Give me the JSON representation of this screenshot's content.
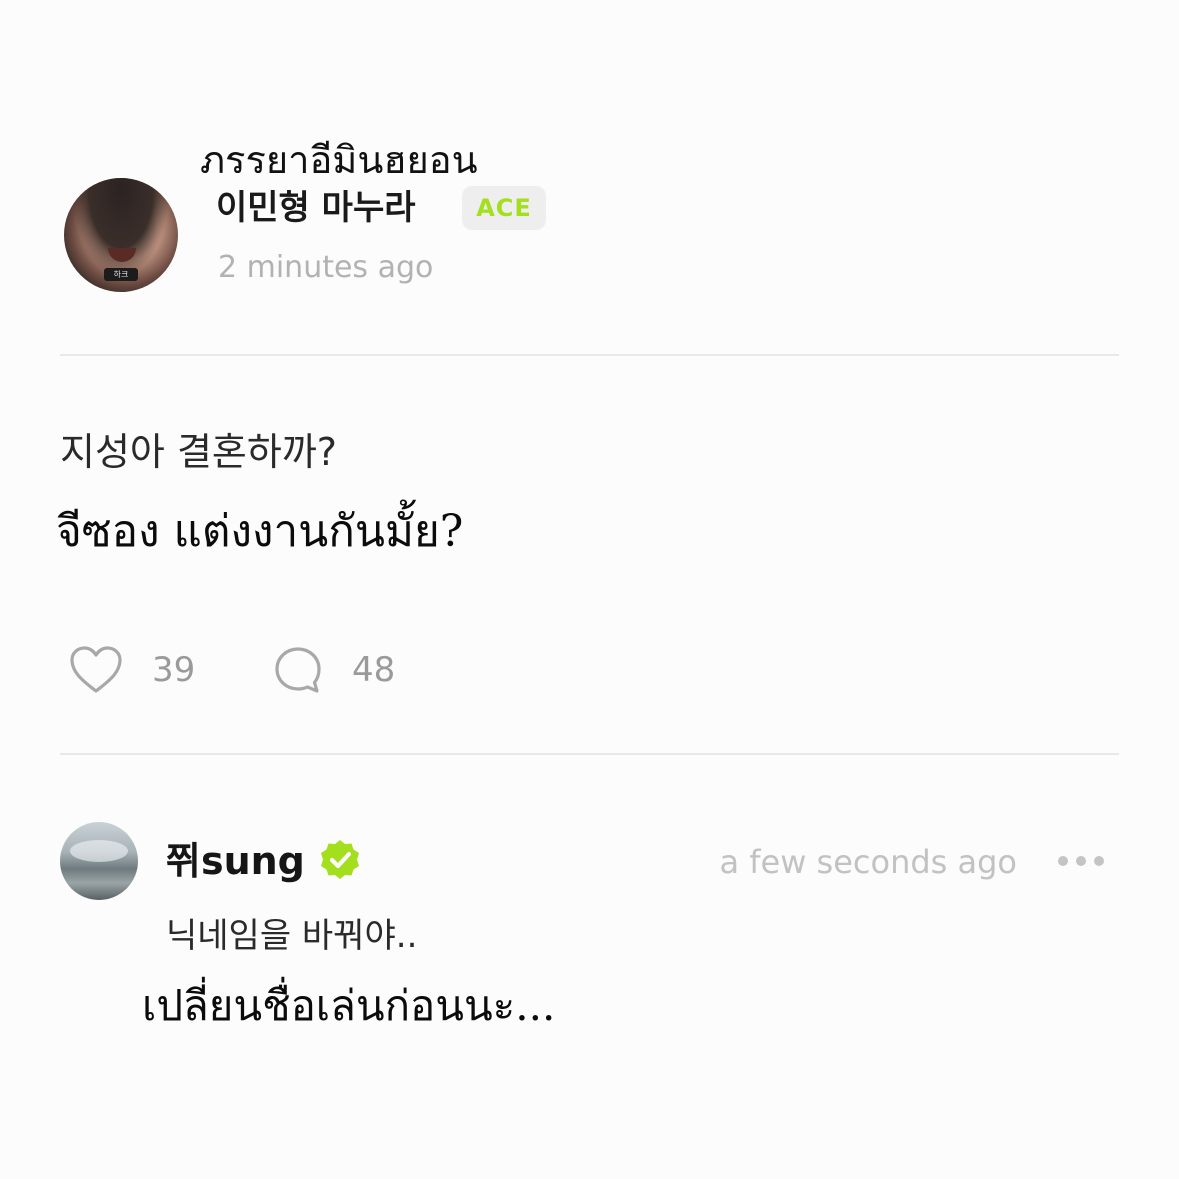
{
  "post": {
    "author": {
      "name_thai": "ภรรยาอีมินฮยอน",
      "name_korean": "이민형 마누라",
      "badge": "ACE",
      "avatar_tag": "하크"
    },
    "timestamp": "2 minutes ago",
    "text_korean": "지성아 결혼하까?",
    "text_thai": "จีซอง แต่งงานกันมั้ย?",
    "likes": "39",
    "comments": "48",
    "like_icon": "heart-icon",
    "comment_icon": "speech-bubble-icon"
  },
  "comment": {
    "author_name": "쮜sung",
    "verified_icon": "verified-badge-icon",
    "timestamp": "a few seconds ago",
    "more_icon": "more-options-icon",
    "text_korean": "닉네임을 바꿔야..",
    "text_thai": "เปลี่ยนชื่อเล่นก่อนนะ..."
  },
  "colors": {
    "accent": "#a3df1c",
    "muted_text": "#b2b2b2",
    "divider": "#e8e8e8"
  }
}
